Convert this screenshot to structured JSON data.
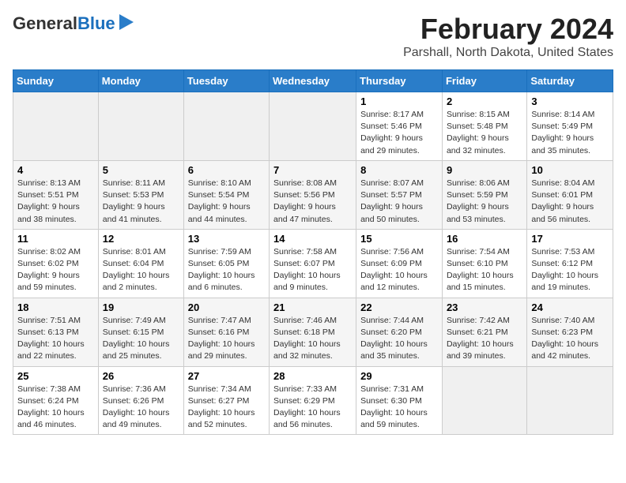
{
  "header": {
    "logo_general": "General",
    "logo_blue": "Blue",
    "title": "February 2024",
    "subtitle": "Parshall, North Dakota, United States"
  },
  "days_of_week": [
    "Sunday",
    "Monday",
    "Tuesday",
    "Wednesday",
    "Thursday",
    "Friday",
    "Saturday"
  ],
  "weeks": [
    [
      {
        "day": "",
        "info": ""
      },
      {
        "day": "",
        "info": ""
      },
      {
        "day": "",
        "info": ""
      },
      {
        "day": "",
        "info": ""
      },
      {
        "day": "1",
        "info": "Sunrise: 8:17 AM\nSunset: 5:46 PM\nDaylight: 9 hours\nand 29 minutes."
      },
      {
        "day": "2",
        "info": "Sunrise: 8:15 AM\nSunset: 5:48 PM\nDaylight: 9 hours\nand 32 minutes."
      },
      {
        "day": "3",
        "info": "Sunrise: 8:14 AM\nSunset: 5:49 PM\nDaylight: 9 hours\nand 35 minutes."
      }
    ],
    [
      {
        "day": "4",
        "info": "Sunrise: 8:13 AM\nSunset: 5:51 PM\nDaylight: 9 hours\nand 38 minutes."
      },
      {
        "day": "5",
        "info": "Sunrise: 8:11 AM\nSunset: 5:53 PM\nDaylight: 9 hours\nand 41 minutes."
      },
      {
        "day": "6",
        "info": "Sunrise: 8:10 AM\nSunset: 5:54 PM\nDaylight: 9 hours\nand 44 minutes."
      },
      {
        "day": "7",
        "info": "Sunrise: 8:08 AM\nSunset: 5:56 PM\nDaylight: 9 hours\nand 47 minutes."
      },
      {
        "day": "8",
        "info": "Sunrise: 8:07 AM\nSunset: 5:57 PM\nDaylight: 9 hours\nand 50 minutes."
      },
      {
        "day": "9",
        "info": "Sunrise: 8:06 AM\nSunset: 5:59 PM\nDaylight: 9 hours\nand 53 minutes."
      },
      {
        "day": "10",
        "info": "Sunrise: 8:04 AM\nSunset: 6:01 PM\nDaylight: 9 hours\nand 56 minutes."
      }
    ],
    [
      {
        "day": "11",
        "info": "Sunrise: 8:02 AM\nSunset: 6:02 PM\nDaylight: 9 hours\nand 59 minutes."
      },
      {
        "day": "12",
        "info": "Sunrise: 8:01 AM\nSunset: 6:04 PM\nDaylight: 10 hours\nand 2 minutes."
      },
      {
        "day": "13",
        "info": "Sunrise: 7:59 AM\nSunset: 6:05 PM\nDaylight: 10 hours\nand 6 minutes."
      },
      {
        "day": "14",
        "info": "Sunrise: 7:58 AM\nSunset: 6:07 PM\nDaylight: 10 hours\nand 9 minutes."
      },
      {
        "day": "15",
        "info": "Sunrise: 7:56 AM\nSunset: 6:09 PM\nDaylight: 10 hours\nand 12 minutes."
      },
      {
        "day": "16",
        "info": "Sunrise: 7:54 AM\nSunset: 6:10 PM\nDaylight: 10 hours\nand 15 minutes."
      },
      {
        "day": "17",
        "info": "Sunrise: 7:53 AM\nSunset: 6:12 PM\nDaylight: 10 hours\nand 19 minutes."
      }
    ],
    [
      {
        "day": "18",
        "info": "Sunrise: 7:51 AM\nSunset: 6:13 PM\nDaylight: 10 hours\nand 22 minutes."
      },
      {
        "day": "19",
        "info": "Sunrise: 7:49 AM\nSunset: 6:15 PM\nDaylight: 10 hours\nand 25 minutes."
      },
      {
        "day": "20",
        "info": "Sunrise: 7:47 AM\nSunset: 6:16 PM\nDaylight: 10 hours\nand 29 minutes."
      },
      {
        "day": "21",
        "info": "Sunrise: 7:46 AM\nSunset: 6:18 PM\nDaylight: 10 hours\nand 32 minutes."
      },
      {
        "day": "22",
        "info": "Sunrise: 7:44 AM\nSunset: 6:20 PM\nDaylight: 10 hours\nand 35 minutes."
      },
      {
        "day": "23",
        "info": "Sunrise: 7:42 AM\nSunset: 6:21 PM\nDaylight: 10 hours\nand 39 minutes."
      },
      {
        "day": "24",
        "info": "Sunrise: 7:40 AM\nSunset: 6:23 PM\nDaylight: 10 hours\nand 42 minutes."
      }
    ],
    [
      {
        "day": "25",
        "info": "Sunrise: 7:38 AM\nSunset: 6:24 PM\nDaylight: 10 hours\nand 46 minutes."
      },
      {
        "day": "26",
        "info": "Sunrise: 7:36 AM\nSunset: 6:26 PM\nDaylight: 10 hours\nand 49 minutes."
      },
      {
        "day": "27",
        "info": "Sunrise: 7:34 AM\nSunset: 6:27 PM\nDaylight: 10 hours\nand 52 minutes."
      },
      {
        "day": "28",
        "info": "Sunrise: 7:33 AM\nSunset: 6:29 PM\nDaylight: 10 hours\nand 56 minutes."
      },
      {
        "day": "29",
        "info": "Sunrise: 7:31 AM\nSunset: 6:30 PM\nDaylight: 10 hours\nand 59 minutes."
      },
      {
        "day": "",
        "info": ""
      },
      {
        "day": "",
        "info": ""
      }
    ]
  ]
}
